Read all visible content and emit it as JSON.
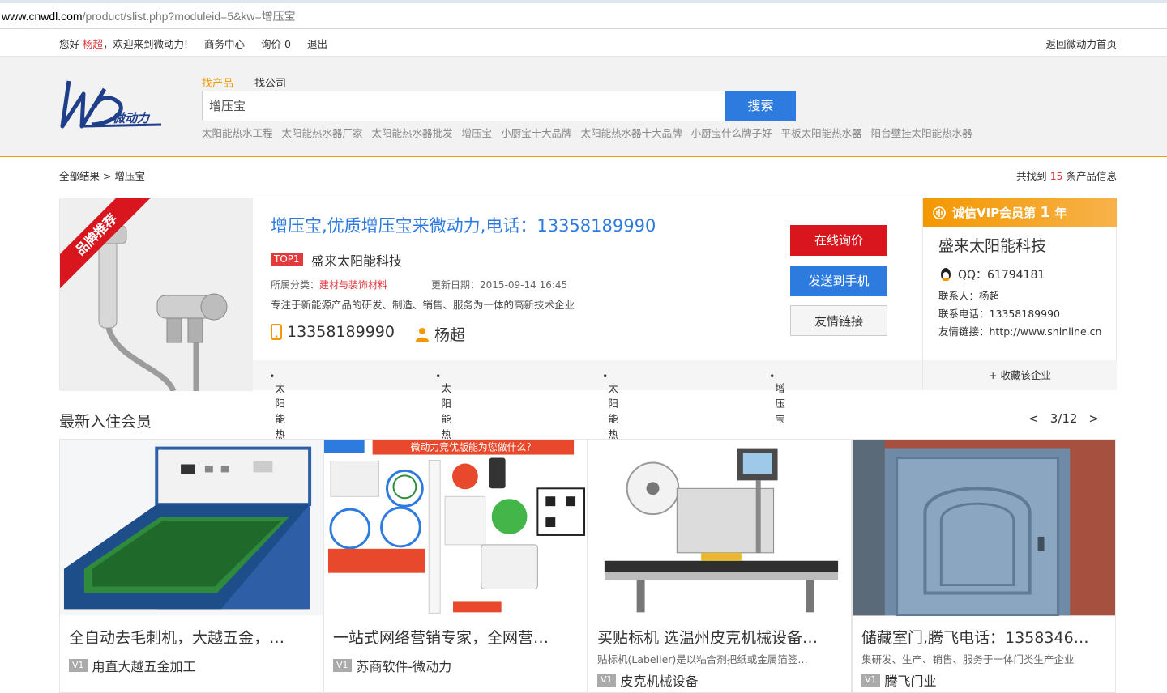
{
  "url": {
    "host": "www.cnwdl.com",
    "path": "/product/slist.php?moduleid=5&kw=增压宝"
  },
  "topnav": {
    "greeting": "您好",
    "username": "杨超",
    "welcome": "，欢迎来到微动力!",
    "links": [
      "商务中心",
      "询价 0",
      "退出"
    ],
    "home": "返回微动力首页"
  },
  "header": {
    "logo_text": "微动力",
    "tabs": [
      "找产品",
      "找公司"
    ],
    "search_value": "增压宝",
    "search_button": "搜索",
    "hotwords": [
      "太阳能热水工程",
      "太阳能热水器厂家",
      "太阳能热水器批发",
      "增压宝",
      "小厨宝十大品牌",
      "太阳能热水器十大品牌",
      "小厨宝什么牌子好",
      "平板太阳能热水器",
      "阳台壁挂太阳能热水器"
    ]
  },
  "breadcrumb": {
    "root": "全部结果",
    "sep": ">",
    "current": "增压宝"
  },
  "result_count": {
    "prefix": "共找到",
    "num": "15",
    "suffix": "条产品信息"
  },
  "featured": {
    "ribbon": "品牌推荐",
    "title": "增压宝,优质增压宝来微动力,电话：13358189990",
    "top_badge": "TOP1",
    "company": "盛来太阳能科技",
    "category_label": "所属分类：",
    "category": "建材与装饰材料",
    "updated": "更新日期：2015-09-14 16:45",
    "desc": "专注于新能源产品的研发、制造、销售、服务为一体的高新技术企业",
    "phone": "13358189990",
    "contact": "杨超",
    "buttons": {
      "inquiry": "在线询价",
      "send": "发送到手机",
      "link": "友情链接"
    },
    "tags": [
      "太阳能热水工程",
      "太阳能热水器厂家",
      "太阳能热水器批发",
      "增压宝"
    ],
    "vip": {
      "header": "诚信VIP会员第",
      "year_num": "1",
      "year_unit": "年",
      "name": "盛来太阳能科技",
      "qq": "QQ：61794181",
      "contact": "联系人：杨超",
      "phone": "联系电话：13358189990",
      "link": "友情链接：http://www.shinline.cn",
      "favorite": "+ 收藏该企业"
    }
  },
  "members": {
    "title": "最新入住会员",
    "pager": {
      "prev": "<",
      "page": "3/12",
      "next": ">"
    },
    "banner_title": "微动力竞优版能为您做什么？",
    "cards": [
      {
        "title": "全自动去毛刺机，大越五金，…",
        "desc": "",
        "badge": "V1",
        "company": "甪直大越五金加工"
      },
      {
        "title": "一站式网络营销专家，全网营…",
        "desc": "",
        "badge": "V1",
        "company": "苏商软件-微动力"
      },
      {
        "title": "买贴标机 选温州皮克机械设备…",
        "desc": "贴标机(Labeller)是以粘合剂把纸或金属箔签…",
        "badge": "V1",
        "company": "皮克机械设备"
      },
      {
        "title": "储藏室门,腾飞电话：1358346…",
        "desc": "集研发、生产、销售、服务于一体门类生产企业",
        "badge": "V1",
        "company": "腾飞门业"
      }
    ]
  },
  "colors": {
    "accent_orange": "#f39800",
    "brand_blue": "#2e7be0",
    "brand_red": "#d9161d"
  }
}
